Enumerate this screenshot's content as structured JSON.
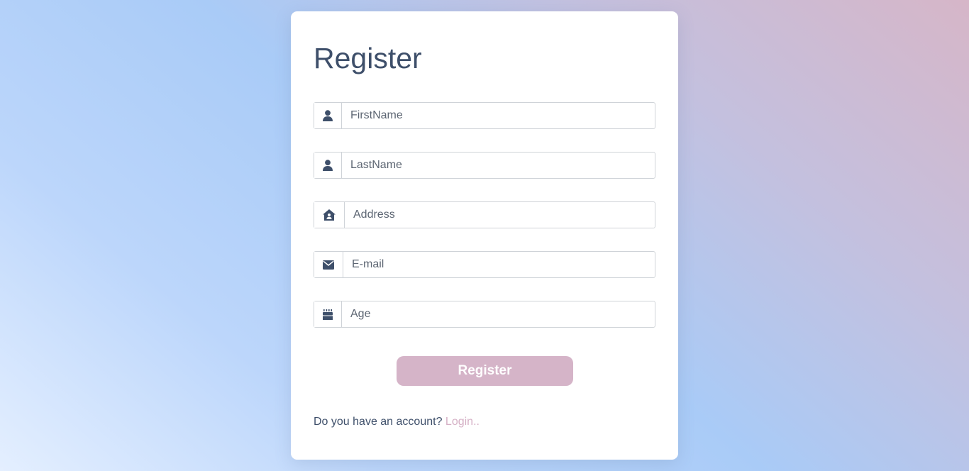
{
  "form": {
    "title": "Register",
    "fields": [
      {
        "icon": "user-icon",
        "placeholder": "FirstName",
        "value": ""
      },
      {
        "icon": "user-icon",
        "placeholder": "LastName",
        "value": ""
      },
      {
        "icon": "house-user-icon",
        "placeholder": "Address",
        "value": ""
      },
      {
        "icon": "envelope-icon",
        "placeholder": "E-mail",
        "value": ""
      },
      {
        "icon": "birthday-cake-icon",
        "placeholder": "Age",
        "value": ""
      }
    ],
    "submit_label": "Register",
    "footer_text": "Do you have an account?",
    "login_link": "Login.."
  },
  "colors": {
    "accent": "#d5b4c8",
    "text": "#3e4f6a",
    "link": "#d5b0c5"
  }
}
